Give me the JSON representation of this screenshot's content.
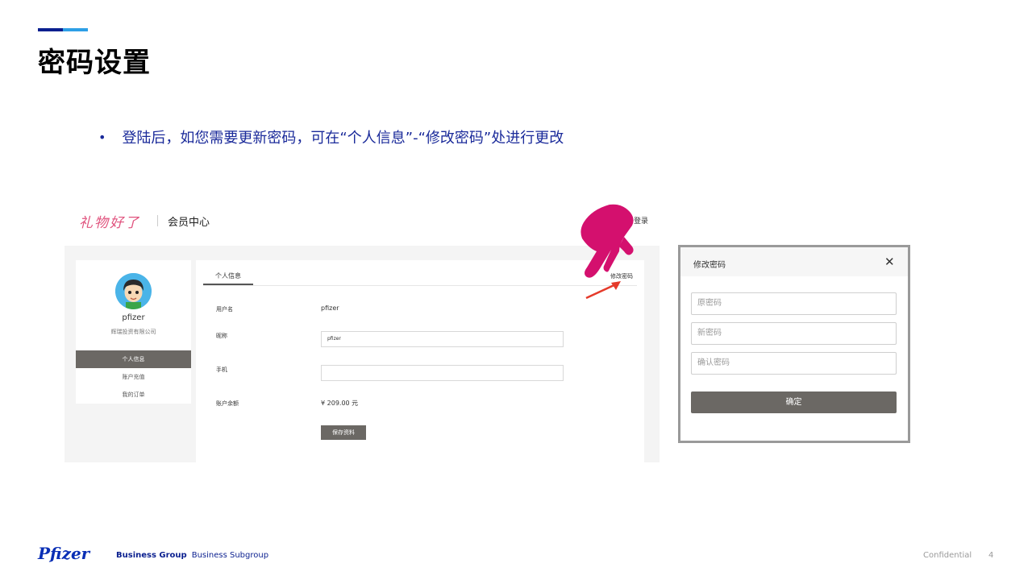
{
  "slide": {
    "title": "密码设置",
    "bullet": "登陆后，如您需要更新密码，可在“个人信息”-“修改密码”处进行更改"
  },
  "site": {
    "brand_logo": "礼物好了",
    "section": "会员中心",
    "login_link": "登录",
    "profile": {
      "username": "pfizer",
      "company": "辉瑞投资有限公司"
    },
    "menu": [
      "个人信息",
      "账户充值",
      "我的订单"
    ],
    "active_menu": "个人信息",
    "tab": "个人信息",
    "change_password_link": "修改密码",
    "form": {
      "username_label": "用户名",
      "username_value": "pfizer",
      "nickname_label": "昵称",
      "nickname_value": "pfizer",
      "phone_label": "手机",
      "phone_value": "",
      "balance_label": "账户余额",
      "balance_value": "¥ 209.00 元",
      "save_button": "保存资料"
    }
  },
  "modal": {
    "title": "修改密码",
    "close": "✕",
    "old_password_placeholder": "原密码",
    "new_password_placeholder": "新密码",
    "confirm_password_placeholder": "确认密码",
    "confirm_button": "确定"
  },
  "footer": {
    "logo": "Pfizer",
    "group": "Business Group",
    "subgroup": "Business Subgroup",
    "confidential": "Confidential",
    "page": "4"
  },
  "colors": {
    "accent_dark": "#0a1f8f",
    "accent_light": "#2d9fe6",
    "bullet_text": "#1a2a9a",
    "button_gray": "#6b6864",
    "hand_magenta": "#d4106e",
    "arrow_red": "#e53a2a"
  }
}
